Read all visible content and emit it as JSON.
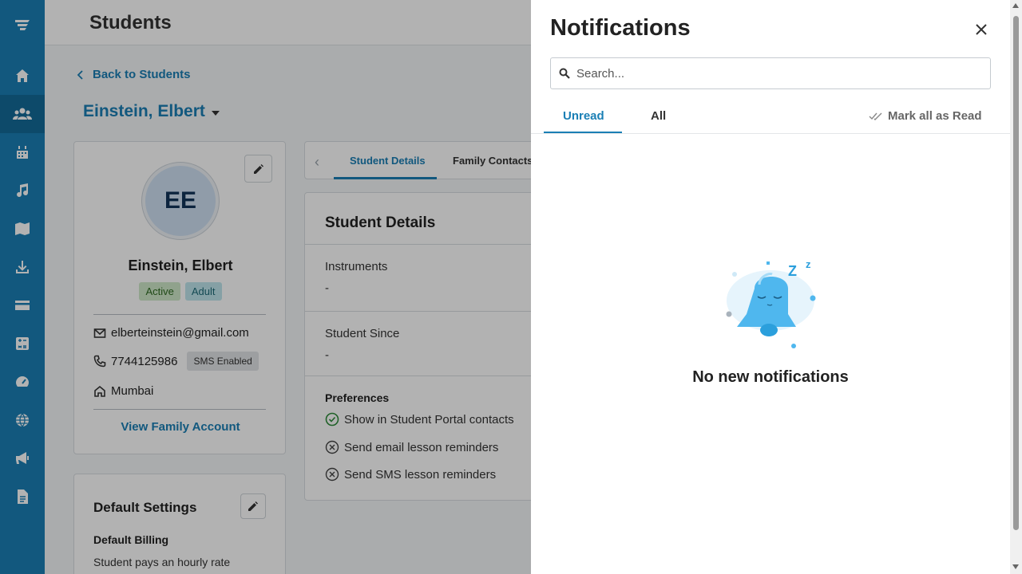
{
  "sidebar": {
    "items": [
      {
        "icon": "home-icon"
      },
      {
        "icon": "students-icon",
        "active": true
      },
      {
        "icon": "calendar-icon"
      },
      {
        "icon": "music-icon"
      },
      {
        "icon": "book-icon"
      },
      {
        "icon": "download-icon"
      },
      {
        "icon": "credit-card-icon"
      },
      {
        "icon": "calculator-icon"
      },
      {
        "icon": "dashboard-icon"
      },
      {
        "icon": "globe-icon"
      },
      {
        "icon": "megaphone-icon"
      },
      {
        "icon": "document-icon"
      }
    ]
  },
  "header": {
    "title": "Students"
  },
  "back_link": "Back to Students",
  "student": {
    "name": "Einstein, Elbert",
    "initials": "EE",
    "status_badge": "Active",
    "type_badge": "Adult",
    "email": "elberteinstein@gmail.com",
    "phone": "7744125986",
    "sms_badge": "SMS Enabled",
    "city": "Mumbai",
    "view_family": "View Family Account"
  },
  "default_settings": {
    "title": "Default Settings",
    "billing_label": "Default Billing",
    "billing_text": "Student pays an hourly rate"
  },
  "tabs": [
    "Student Details",
    "Family Contacts"
  ],
  "details": {
    "title": "Student Details",
    "instruments_label": "Instruments",
    "instruments_value": "-",
    "since_label": "Student Since",
    "since_value": "-",
    "preferences_label": "Preferences",
    "preferences": [
      {
        "label": "Show in Student Portal contacts",
        "enabled": true
      },
      {
        "label": "Send email lesson reminders",
        "enabled": false
      },
      {
        "label": "Send SMS lesson reminders",
        "enabled": false
      }
    ]
  },
  "notifications": {
    "title": "Notifications",
    "search_placeholder": "Search...",
    "tab_unread": "Unread",
    "tab_all": "All",
    "mark_all": "Mark all as Read",
    "empty_text": "No new notifications",
    "zz": "Z",
    "z": "z"
  },
  "colors": {
    "brand": "#1a7fb5",
    "bell": "#4fb7ee"
  }
}
